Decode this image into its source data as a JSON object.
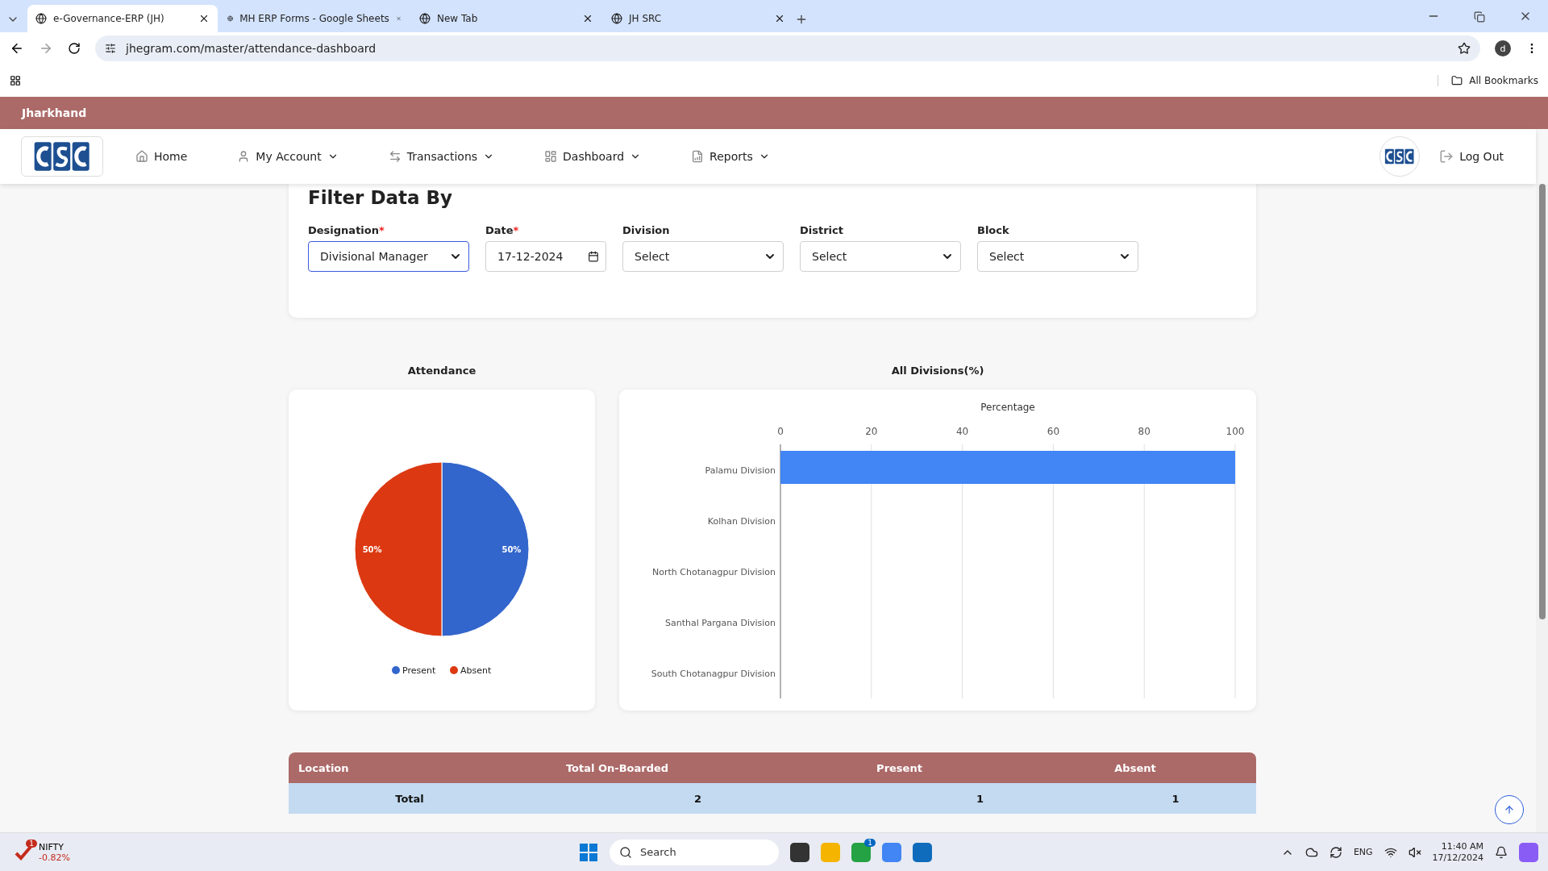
{
  "browser": {
    "tabs": [
      {
        "title": "e-Governance-ERP (JH)",
        "selected": true
      },
      {
        "title": "MH ERP Forms - Google Sheets",
        "selected": false
      },
      {
        "title": "New Tab",
        "selected": false
      },
      {
        "title": "JH SRC",
        "selected": false
      }
    ],
    "address": "jhegram.com/master/attendance-dashboard",
    "profile": "d",
    "bookmarks_label": "All Bookmarks"
  },
  "state_bar": {
    "title": "Jharkhand"
  },
  "nav": {
    "items": [
      {
        "label": "Home",
        "dropdown": false
      },
      {
        "label": "My Account",
        "dropdown": true
      },
      {
        "label": "Transactions",
        "dropdown": true
      },
      {
        "label": "Dashboard",
        "dropdown": true
      },
      {
        "label": "Reports",
        "dropdown": true
      }
    ],
    "logout": "Log Out"
  },
  "filter": {
    "title": "Filter Data By",
    "fields": [
      {
        "label": "Designation",
        "required_mark": "*",
        "kind": "select",
        "value": "Divisional Manager",
        "focused": true
      },
      {
        "label": "Date",
        "required_mark": "*",
        "kind": "date",
        "value": "17-12-2024",
        "focused": false
      },
      {
        "label": "Division",
        "kind": "select",
        "value": "Select",
        "focused": false
      },
      {
        "label": "District",
        "kind": "select",
        "value": "Select",
        "focused": false
      },
      {
        "label": "Block",
        "kind": "select",
        "value": "Select",
        "focused": false
      }
    ]
  },
  "attendance": {
    "title": "Attendance",
    "chart_data": {
      "type": "pie",
      "categories": [
        "Present",
        "Absent"
      ],
      "values": [
        50,
        50
      ],
      "colors": [
        "#3366cc",
        "#dc3912"
      ],
      "value_labels": [
        "50%",
        "50%"
      ],
      "legend": true
    }
  },
  "divisions": {
    "title": "All Divisions(%)",
    "chart_data": {
      "type": "bar",
      "orientation": "horizontal",
      "xlabel": "Percentage",
      "categories": [
        "Palamu Division",
        "Kolhan Division",
        "North Chotanagpur Division",
        "Santhal Pargana Division",
        "South Chotanagpur Division"
      ],
      "series": [
        {
          "color": "#4285f4",
          "values": [
            100,
            0,
            0,
            0,
            0
          ]
        }
      ],
      "xlim": [
        0,
        100
      ],
      "xticks": [
        0,
        20,
        40,
        60,
        80,
        100
      ],
      "grid": true
    }
  },
  "table": {
    "columns": [
      "Location",
      "Total On-Boarded",
      "Present",
      "Absent"
    ],
    "rows": [
      {
        "cells": [
          "Total",
          "2",
          "1",
          "1"
        ],
        "total": true
      }
    ]
  },
  "taskbar": {
    "stock": {
      "name": "NIFTY",
      "change": "-0.82%",
      "badge": "1"
    },
    "search": "Search",
    "whatsapp_badge": "1",
    "language": "ENG",
    "time": "11:40 AM",
    "date": "17/12/2024"
  }
}
